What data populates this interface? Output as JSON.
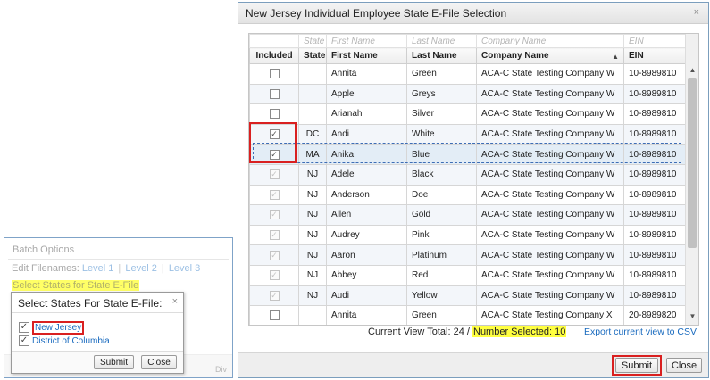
{
  "batch_options": {
    "title": "Batch Options",
    "edit_filenames_label": "Edit Filenames:",
    "levels": [
      "Level 1",
      "Level 2",
      "Level 3"
    ],
    "select_states_link": "Select States for State E-File",
    "div_label": "Div"
  },
  "state_popup": {
    "title": "Select States For State E-File:",
    "close_glyph": "×",
    "options": [
      {
        "label": "New Jersey",
        "checked": true,
        "check_glyph": "✓"
      },
      {
        "label": "District of Columbia",
        "checked": true,
        "check_glyph": "✓"
      }
    ],
    "submit_label": "Submit",
    "close_label": "Close"
  },
  "dialog": {
    "title": "New Jersey Individual Employee State E-File Selection",
    "close_glyph": "×",
    "filter_placeholders": {
      "state": "State",
      "first": "First Name",
      "last": "Last Name",
      "company": "Company Name",
      "ein": "EIN"
    },
    "columns": {
      "included": "Included",
      "state": "State",
      "first": "First Name",
      "last": "Last Name",
      "company": "Company Name",
      "ein": "EIN"
    },
    "sort_arrow": "▲",
    "rows": [
      {
        "included": false,
        "disabled": false,
        "state": "",
        "first": "Annita",
        "last": "Green",
        "company": "ACA-C State Testing Company W",
        "ein": "10-8989810"
      },
      {
        "included": false,
        "disabled": false,
        "state": "",
        "first": "Apple",
        "last": "Greys",
        "company": "ACA-C State Testing Company W",
        "ein": "10-8989810"
      },
      {
        "included": false,
        "disabled": false,
        "state": "",
        "first": "Arianah",
        "last": "Silver",
        "company": "ACA-C State Testing Company W",
        "ein": "10-8989810"
      },
      {
        "included": true,
        "disabled": false,
        "state": "DC",
        "first": "Andi",
        "last": "White",
        "company": "ACA-C State Testing Company W",
        "ein": "10-8989810"
      },
      {
        "included": true,
        "disabled": false,
        "state": "MA",
        "first": "Anika",
        "last": "Blue",
        "company": "ACA-C State Testing Company W",
        "ein": "10-8989810"
      },
      {
        "included": true,
        "disabled": true,
        "state": "NJ",
        "first": "Adele",
        "last": "Black",
        "company": "ACA-C State Testing Company W",
        "ein": "10-8989810"
      },
      {
        "included": true,
        "disabled": true,
        "state": "NJ",
        "first": "Anderson",
        "last": "Doe",
        "company": "ACA-C State Testing Company W",
        "ein": "10-8989810"
      },
      {
        "included": true,
        "disabled": true,
        "state": "NJ",
        "first": "Allen",
        "last": "Gold",
        "company": "ACA-C State Testing Company W",
        "ein": "10-8989810"
      },
      {
        "included": true,
        "disabled": true,
        "state": "NJ",
        "first": "Audrey",
        "last": "Pink",
        "company": "ACA-C State Testing Company W",
        "ein": "10-8989810"
      },
      {
        "included": true,
        "disabled": true,
        "state": "NJ",
        "first": "Aaron",
        "last": "Platinum",
        "company": "ACA-C State Testing Company W",
        "ein": "10-8989810"
      },
      {
        "included": true,
        "disabled": true,
        "state": "NJ",
        "first": "Abbey",
        "last": "Red",
        "company": "ACA-C State Testing Company W",
        "ein": "10-8989810"
      },
      {
        "included": true,
        "disabled": true,
        "state": "NJ",
        "first": "Audi",
        "last": "Yellow",
        "company": "ACA-C State Testing Company W",
        "ein": "10-8989810"
      },
      {
        "included": false,
        "disabled": false,
        "state": "",
        "first": "Annita",
        "last": "Green",
        "company": "ACA-C State Testing Company X",
        "ein": "20-8989820"
      }
    ],
    "check_glyph": "✓",
    "status_prefix": "Current View Total: 24 /",
    "number_selected": "Number Selected: 10",
    "export_link": "Export current view to CSV",
    "submit_label": "Submit",
    "close_label": "Close",
    "scroll_up_glyph": "▲",
    "scroll_down_glyph": "▼"
  },
  "colors": {
    "highlight_yellow": "#ffff40",
    "highlight_red": "#d92020",
    "link_blue": "#1a6bbf",
    "border_blue": "#7b9ebd"
  }
}
